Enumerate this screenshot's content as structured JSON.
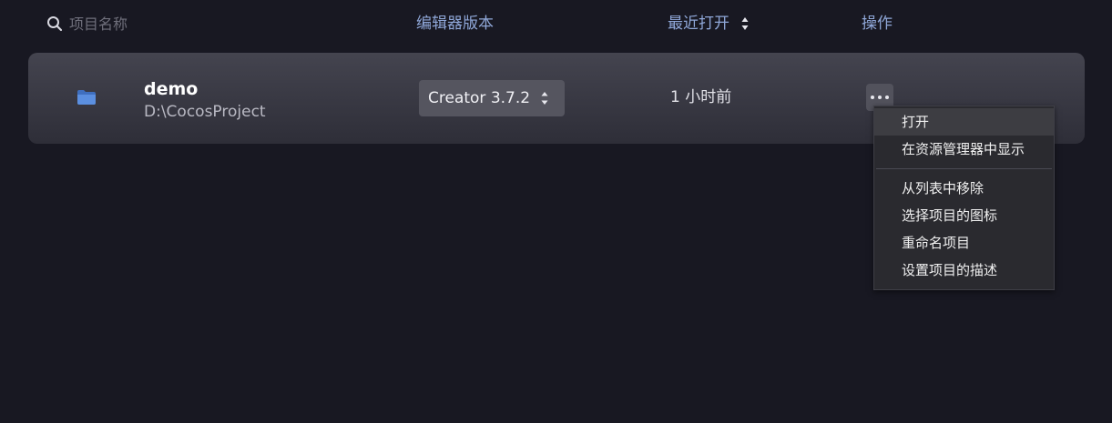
{
  "search": {
    "placeholder": "项目名称",
    "icon": "search-icon"
  },
  "columns": {
    "editor_version": "编辑器版本",
    "last_opened": "最近打开",
    "actions": "操作"
  },
  "project": {
    "name": "demo",
    "path": "D:\\CocosProject",
    "editor_version": "Creator 3.7.2",
    "last_opened": "1 小时前",
    "icon": "folder-icon"
  },
  "menu": {
    "items_group1": [
      "打开",
      "在资源管理器中显示"
    ],
    "items_group2": [
      "从列表中移除",
      "选择项目的图标",
      "重命名项目",
      "设置项目的描述"
    ]
  },
  "colors": {
    "background": "#181822",
    "header_text": "#8fa7d8",
    "card": "#3a3a44",
    "menu_bg": "#2a2a2f"
  }
}
